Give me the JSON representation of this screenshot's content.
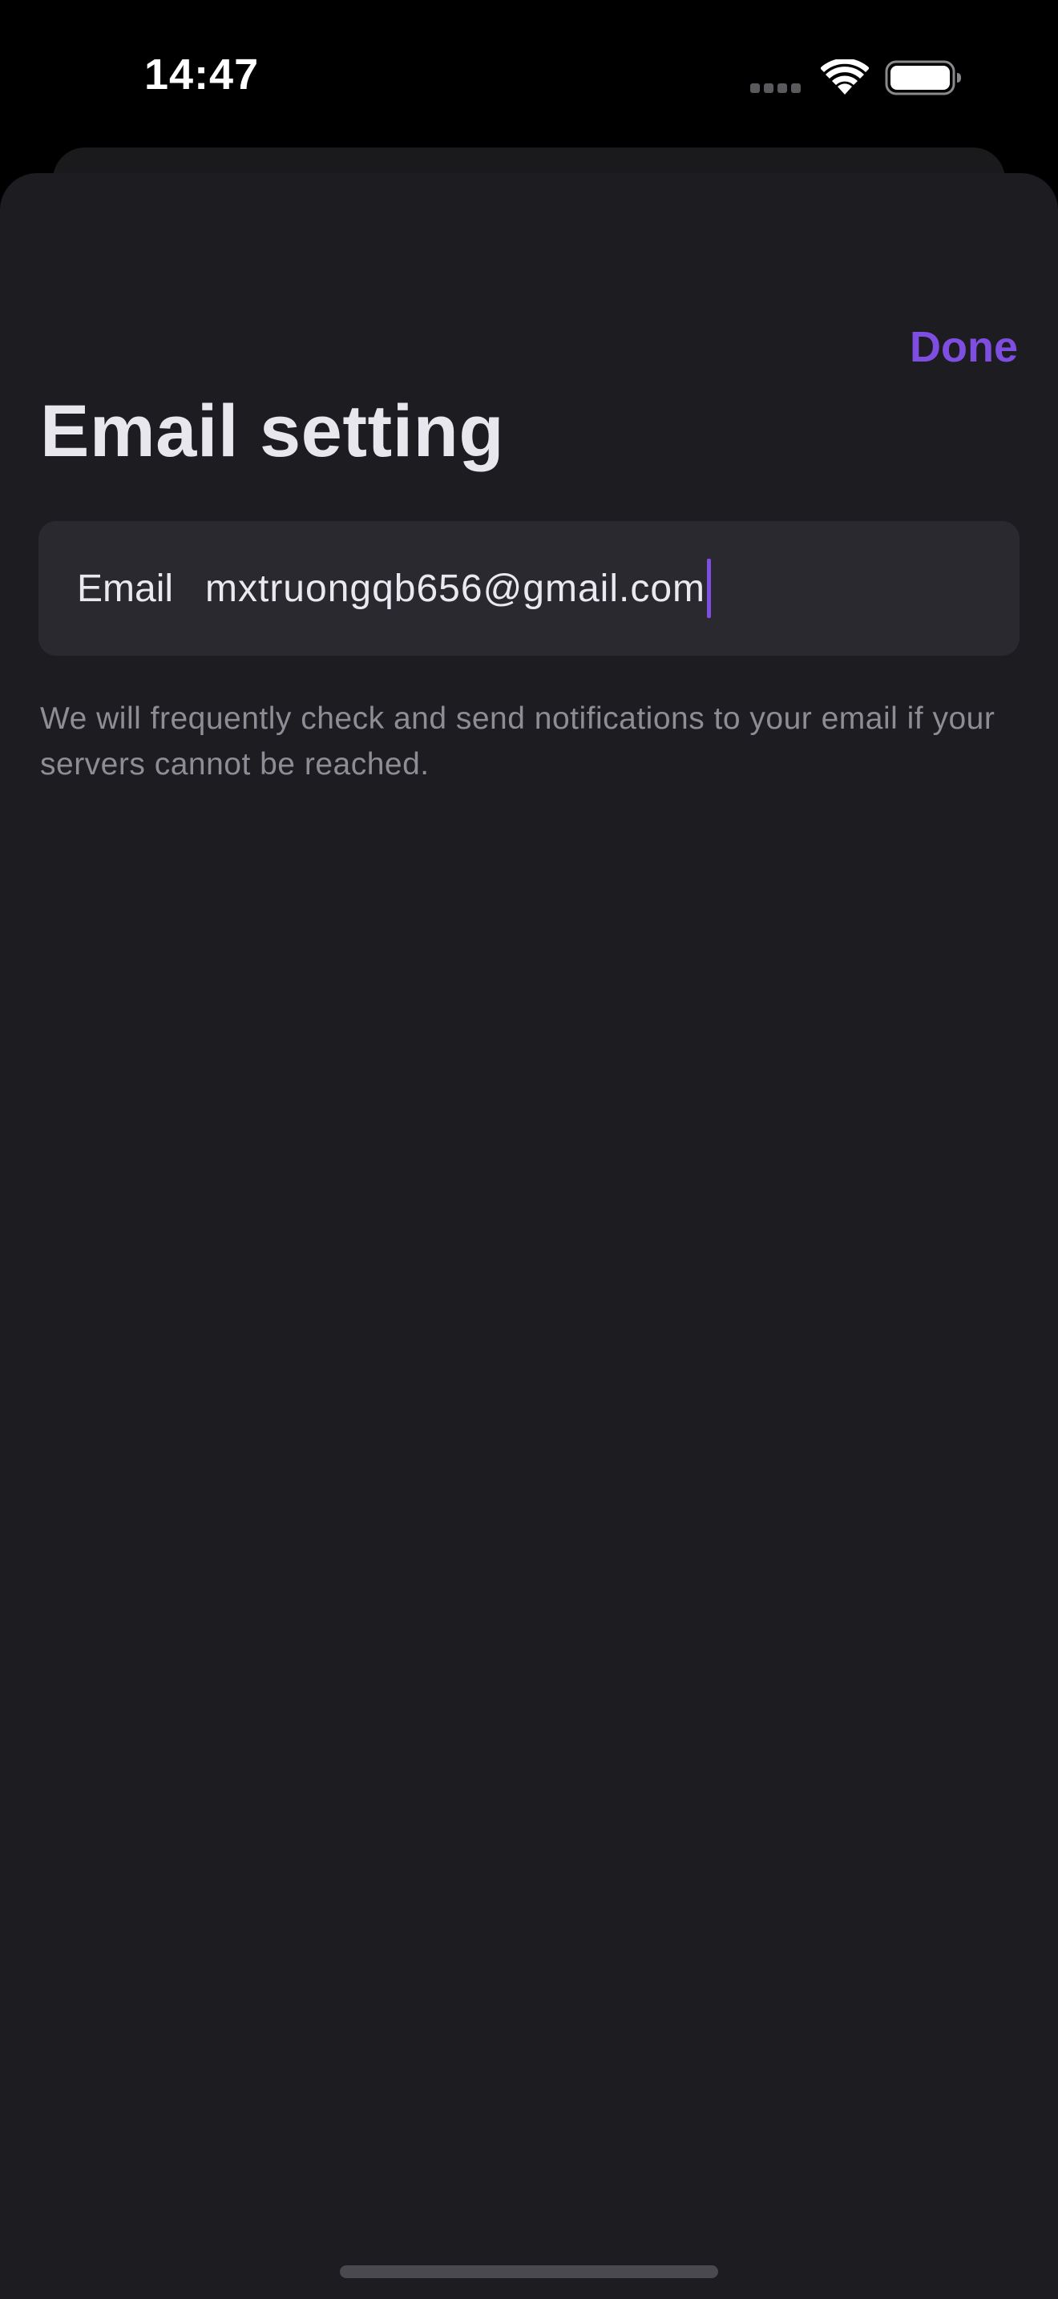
{
  "status_bar": {
    "time": "14:47"
  },
  "header": {
    "done_label": "Done",
    "title": "Email setting"
  },
  "email_field": {
    "label": "Email",
    "value": "mxtruongqb656@gmail.com"
  },
  "helper_text": "We will frequently check and send notifications to your email if your servers cannot be reached.",
  "icons": {
    "signal": "cellular-signal-icon",
    "wifi": "wifi-icon",
    "battery": "battery-icon"
  },
  "colors": {
    "accent": "#7e4ee0",
    "sheet_background": "#1d1c21",
    "field_background": "#2a2930",
    "helper_text": "#8e8c94"
  }
}
